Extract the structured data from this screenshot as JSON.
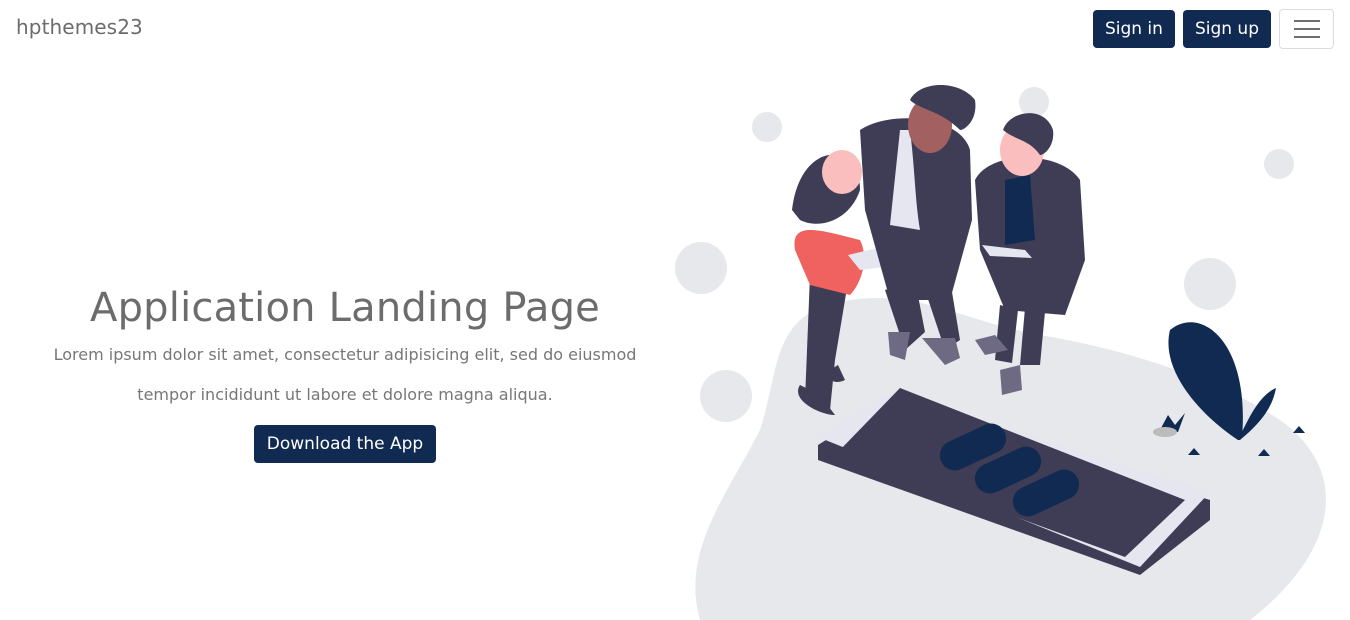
{
  "navbar": {
    "brand": "hpthemes23",
    "sign_in_label": "Sign in",
    "sign_up_label": "Sign up"
  },
  "hero": {
    "title": "Application Landing Page",
    "subtitle_line1": "Lorem ipsum dolor sit amet, consectetur adipisicing elit, sed do eiusmod",
    "subtitle_line2": "tempor incididunt ut labore et dolore magna aliqua.",
    "cta_label": "Download the App"
  },
  "colors": {
    "primary": "#102a52",
    "blob": "#e6e8ec",
    "person_dark": "#3f3d56",
    "accent_red": "#f0625f"
  },
  "icons": [
    "hamburger-menu-icon"
  ]
}
